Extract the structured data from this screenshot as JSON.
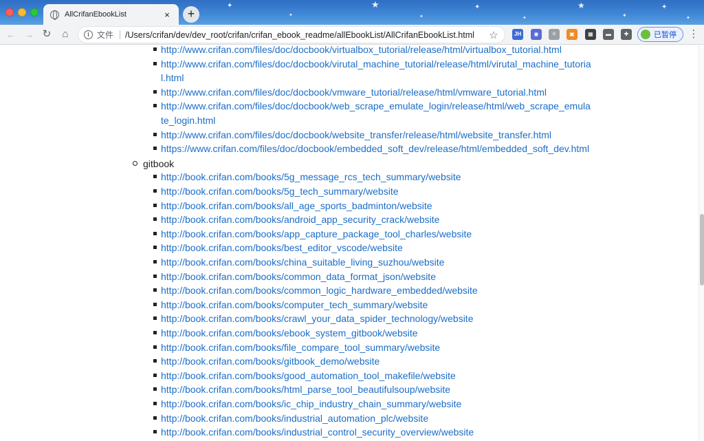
{
  "browser": {
    "tab_title": "AllCrifanEbookList",
    "tab_close": "×",
    "new_tab": "+",
    "back": "←",
    "forward": "→",
    "reload": "↻",
    "home": "⌂",
    "info": "i",
    "scheme_label": "文件",
    "url": "/Users/crifan/dev/dev_root/crifan/crifan_ebook_readme/allEbookList/AllCrifanEbookList.html",
    "bookmark": "☆",
    "extensions": [
      {
        "icon": "jh-extension-icon",
        "text": "JH",
        "color": "#3d6bd6"
      },
      {
        "icon": "translate-extension-icon",
        "text": "◉",
        "color": "#5a6bd6"
      },
      {
        "icon": "react-extension-icon",
        "text": "⚛",
        "color": "#9aa0a6"
      },
      {
        "icon": "orange-extension-icon",
        "text": "▣",
        "color": "#f08a24"
      },
      {
        "icon": "qr-code-icon",
        "text": "▦",
        "color": "#3c4043"
      },
      {
        "icon": "window-extension-icon",
        "text": "▬",
        "color": "#5f6368"
      },
      {
        "icon": "puzzle-icon",
        "text": "✚",
        "color": "#5f6368"
      }
    ],
    "profile_label": "已暂停",
    "menu": "⋮"
  },
  "content": {
    "docbook_links": [
      "http://www.crifan.com/files/doc/docbook/virtualbox_tutorial/release/html/virtualbox_tutorial.html",
      "http://www.crifan.com/files/doc/docbook/virutal_machine_tutorial/release/html/virutal_machine_tutorial.html",
      "http://www.crifan.com/files/doc/docbook/vmware_tutorial/release/html/vmware_tutorial.html",
      "http://www.crifan.com/files/doc/docbook/web_scrape_emulate_login/release/html/web_scrape_emulate_login.html",
      "http://www.crifan.com/files/doc/docbook/website_transfer/release/html/website_transfer.html",
      "https://www.crifan.com/files/doc/docbook/embedded_soft_dev/release/html/embedded_soft_dev.html"
    ],
    "gitbook_label": "gitbook",
    "gitbook_links": [
      "http://book.crifan.com/books/5g_message_rcs_tech_summary/website",
      "http://book.crifan.com/books/5g_tech_summary/website",
      "http://book.crifan.com/books/all_age_sports_badminton/website",
      "http://book.crifan.com/books/android_app_security_crack/website",
      "http://book.crifan.com/books/app_capture_package_tool_charles/website",
      "http://book.crifan.com/books/best_editor_vscode/website",
      "http://book.crifan.com/books/china_suitable_living_suzhou/website",
      "http://book.crifan.com/books/common_data_format_json/website",
      "http://book.crifan.com/books/common_logic_hardware_embedded/website",
      "http://book.crifan.com/books/computer_tech_summary/website",
      "http://book.crifan.com/books/crawl_your_data_spider_technology/website",
      "http://book.crifan.com/books/ebook_system_gitbook/website",
      "http://book.crifan.com/books/file_compare_tool_summary/website",
      "http://book.crifan.com/books/gitbook_demo/website",
      "http://book.crifan.com/books/good_automation_tool_makefile/website",
      "http://book.crifan.com/books/html_parse_tool_beautifulsoup/website",
      "http://book.crifan.com/books/ic_chip_industry_chain_summary/website",
      "http://book.crifan.com/books/industrial_automation_plc/website",
      "http://book.crifan.com/books/industrial_control_security_overview/website"
    ]
  }
}
